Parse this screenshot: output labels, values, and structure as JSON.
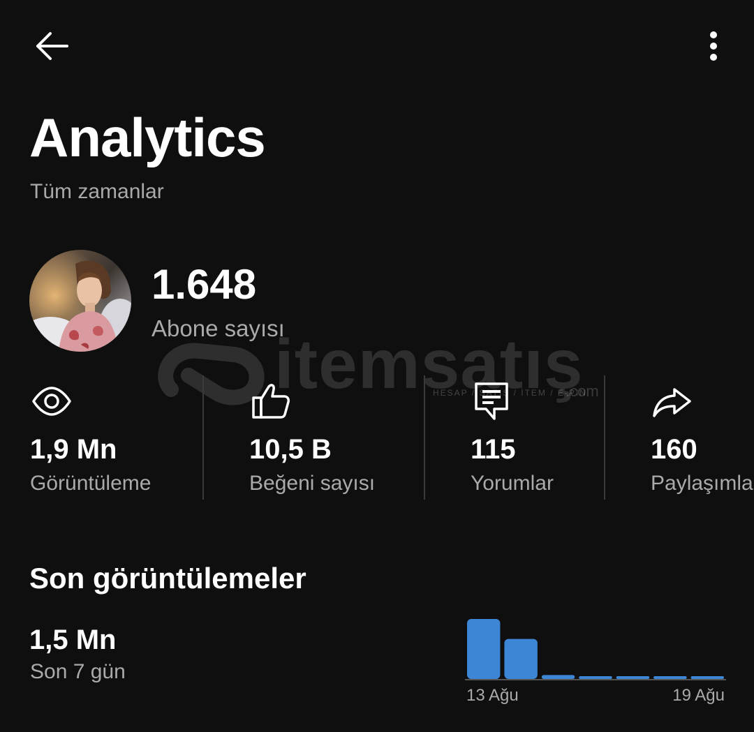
{
  "header": {
    "title": "Analytics",
    "subtitle": "Tüm zamanlar"
  },
  "channel": {
    "subscriber_count": "1.648",
    "subscriber_label": "Abone sayısı"
  },
  "stats": [
    {
      "icon": "eye-icon",
      "value": "1,9 Mn",
      "label": "Görüntüleme"
    },
    {
      "icon": "thumbs-up-icon",
      "value": "10,5 B",
      "label": "Beğeni sayısı"
    },
    {
      "icon": "comment-icon",
      "value": "115",
      "label": "Yorumlar"
    },
    {
      "icon": "share-icon",
      "value": "160",
      "label": "Paylaşımlar"
    }
  ],
  "recent": {
    "section_title": "Son görüntülemeler",
    "value": "1,5 Mn",
    "period_label": "Son 7 gün"
  },
  "chart_data": {
    "type": "bar",
    "tick_labels": [
      "13 Ağu",
      "19 Ağu"
    ],
    "categories": [
      "13 Ağu",
      "14 Ağu",
      "15 Ağu",
      "16 Ağu",
      "17 Ağu",
      "18 Ağu",
      "19 Ağu"
    ],
    "values": [
      840,
      560,
      55,
      35,
      35,
      35,
      35
    ],
    "color": "#3d86d6"
  },
  "watermark": {
    "text": "itemsatış",
    "tagline": "HESAP / SATIŞ / İTEM / E-PIN",
    "suffix": ".com"
  },
  "colors": {
    "background": "#0f0f0f",
    "text_primary": "#ffffff",
    "text_secondary": "#aaaaaa",
    "divider": "#3a3a3a",
    "accent": "#3d86d6"
  }
}
